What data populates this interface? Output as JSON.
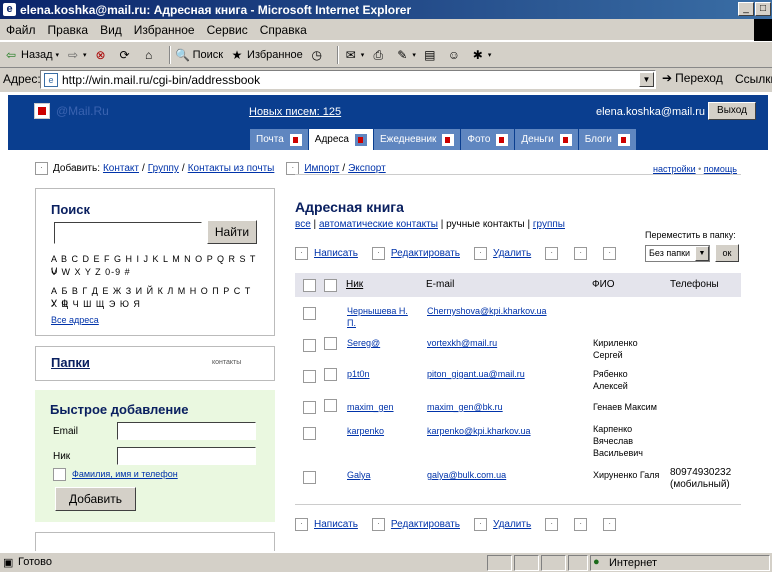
{
  "window": {
    "title": "elena.koshka@mail.ru: Адресная книга - Microsoft Internet Explorer"
  },
  "menu": [
    "Файл",
    "Правка",
    "Вид",
    "Избранное",
    "Сервис",
    "Справка"
  ],
  "toolbar": {
    "back": "Назад",
    "search": "Поиск",
    "favorites": "Избранное"
  },
  "address": {
    "label": "Адрес:",
    "url": "http://win.mail.ru/cgi-bin/addressbook",
    "go": "Переход",
    "links": "Ссылки"
  },
  "header": {
    "site": "@Mail.Ru",
    "new_mail": "Новых писем: 125",
    "user": "elena.koshka@mail.ru",
    "exit": "Выход",
    "tabs": [
      "Почта",
      "Адреса",
      "Ежедневник",
      "Фото",
      "Деньги",
      "Блоги"
    ]
  },
  "subbar": {
    "add_label": "Добавить:",
    "contact": "Контакт",
    "group": "Группу",
    "from_mail": "Контакты из почты",
    "import": "Импорт",
    "export": "Экспорт",
    "settings": "настройки",
    "help": "помощь",
    "slash": "/",
    "dot": "•"
  },
  "search": {
    "title": "Поиск",
    "button": "Найти",
    "latin1": "A B C D E F G H I J K L M N O P Q R S T U",
    "latin2": "V W X Y Z  0-9  #",
    "cyr1": "А Б В Г Д Е Ж З И Й К Л М Н О П Р С Т У Ф",
    "cyr2": "Х Ц Ч Ш Щ Э Ю Я",
    "all": "Все адреса"
  },
  "folders": {
    "title": "Папки",
    "note": "контакты"
  },
  "quick_add": {
    "title": "Быстрое добавление",
    "email_label": "Email",
    "nick_label": "Ник",
    "more": "Фамилия, имя и телефон",
    "button": "Добавить"
  },
  "addressbook": {
    "title": "Адресная книга",
    "all": "все",
    "auto": "автоматические контакты",
    "manual": "ручные контакты",
    "groups": "группы",
    "sep": "|",
    "write": "Написать",
    "edit": "Редактировать",
    "delete": "Удалить",
    "move_label": "Переместить в папку:",
    "folder": "Без папки",
    "ok": "ок",
    "columns": {
      "nick": "Ник",
      "email": "E-mail",
      "fio": "ФИО",
      "phones": "Телефоны"
    },
    "rows": [
      {
        "nick1": "Чернышева Н.",
        "nick2": "П.",
        "email": "Chernyshova@kpi.kharkov.ua",
        "fio1": "",
        "fio2": "",
        "fio3": "",
        "phone1": "",
        "phone2": ""
      },
      {
        "nick1": "Sereg@",
        "nick2": "",
        "email": "vortexkh@mail.ru",
        "fio1": "Кириленко",
        "fio2": "Сергей",
        "fio3": "",
        "phone1": "",
        "phone2": ""
      },
      {
        "nick1": "p1t0n",
        "nick2": "",
        "email": "piton_gigant.ua@mail.ru",
        "fio1": "Рябенко",
        "fio2": "Алексей",
        "fio3": "",
        "phone1": "",
        "phone2": ""
      },
      {
        "nick1": "maxim_gen",
        "nick2": "",
        "email": "maxim_gen@bk.ru",
        "fio1": "Генаев Максим",
        "fio2": "",
        "fio3": "",
        "phone1": "",
        "phone2": ""
      },
      {
        "nick1": "karpenko",
        "nick2": "",
        "email": "karpenko@kpi.kharkov.ua",
        "fio1": "Карпенко",
        "fio2": "Вячеслав",
        "fio3": "Васильевич",
        "phone1": "",
        "phone2": ""
      },
      {
        "nick1": "Galya",
        "nick2": "",
        "email": "galya@bulk.com.ua",
        "fio1": "Хируненко Галя",
        "fio2": "",
        "fio3": "",
        "phone1": "80974930232",
        "phone2": "(мобильный)"
      }
    ]
  },
  "status": {
    "text": "Готово",
    "zone": "Интернет"
  }
}
